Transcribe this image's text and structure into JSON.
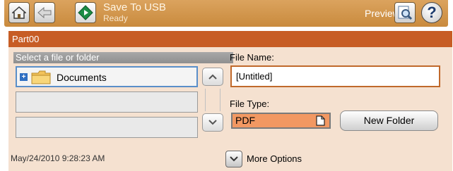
{
  "topbar": {
    "home_icon": "home-icon",
    "back_icon": "back-arrow-icon",
    "start_icon": "start-diamond-icon",
    "title": "Save To USB",
    "status": "Ready",
    "preview_label": "Preview",
    "preview_icon": "magnifier-icon",
    "help_icon": "help-icon",
    "help_glyph": "?"
  },
  "header": {
    "part": "Part00"
  },
  "file_list": {
    "header": "Select a file or folder",
    "rows": [
      {
        "label": "Documents",
        "expand_glyph": "+",
        "icon": "folder-icon",
        "selected": true
      },
      {
        "label": ""
      },
      {
        "label": ""
      }
    ],
    "scroll_up_icon": "chevron-up-icon",
    "scroll_down_icon": "chevron-down-icon"
  },
  "file_name": {
    "label": "File Name:",
    "value": "[Untitled]"
  },
  "file_type": {
    "label": "File Type:",
    "value": "PDF",
    "icon": "document-icon"
  },
  "new_folder_label": "New Folder",
  "footer": {
    "datetime": "May/24/2010 9:28:23 AM",
    "more_options_label": "More Options",
    "more_options_icon": "chevron-down-icon"
  },
  "colors": {
    "topbar": "#c98a3d",
    "part_header": "#c75d25",
    "panel_bg": "#f5e1d0",
    "file_type_fill": "#f29862",
    "input_border": "#c0692b"
  }
}
